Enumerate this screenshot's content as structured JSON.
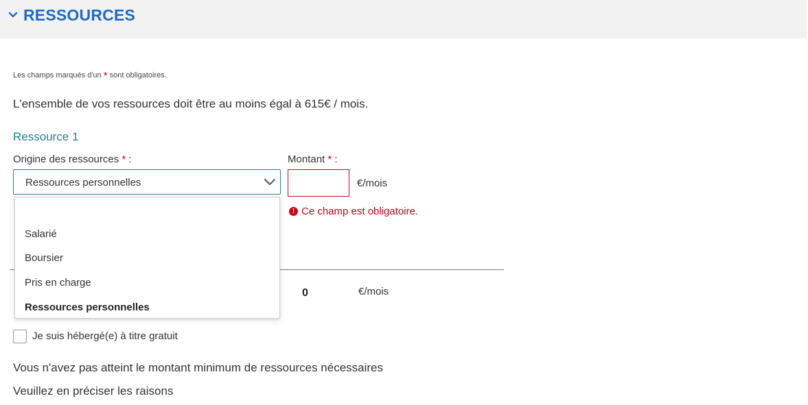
{
  "section": {
    "title": "RESSOURCES",
    "toggle_icon": "chevron-down-icon"
  },
  "required_note": {
    "before": "Les champs marqués d'un",
    "star": "*",
    "after": "sont obligatoires."
  },
  "intro": "L'ensemble de vos ressources doit être au moins égal à 615€ / mois.",
  "resource": {
    "title": "Ressource 1",
    "origin_label": "Origine des ressources",
    "amount_label": "Montant",
    "required_star": "*",
    "label_suffix": ":",
    "selected_origin": "Ressources personnelles",
    "amount_value": "",
    "amount_unit": "€/mois",
    "error": "Ce champ est obligatoire.",
    "error_icon": "!"
  },
  "dropdown": {
    "options": [
      "",
      "Salarié",
      "Boursier",
      "Pris en charge",
      "Ressources personnelles"
    ],
    "selected_index": 4
  },
  "total": {
    "value": "0",
    "unit": "€/mois"
  },
  "hosted": {
    "label": "Je suis hébergé(e) à titre gratuit",
    "checked": false
  },
  "messages": {
    "not_reached": "Vous n'avez pas atteint le montant minimum de ressources nécessaires",
    "please_specify": "Veuillez en préciser les raisons"
  },
  "colors": {
    "title_blue": "#1b6ac9",
    "teal": "#2a7f90",
    "error_red": "#d0021b",
    "header_bg": "#f2f2f2"
  }
}
